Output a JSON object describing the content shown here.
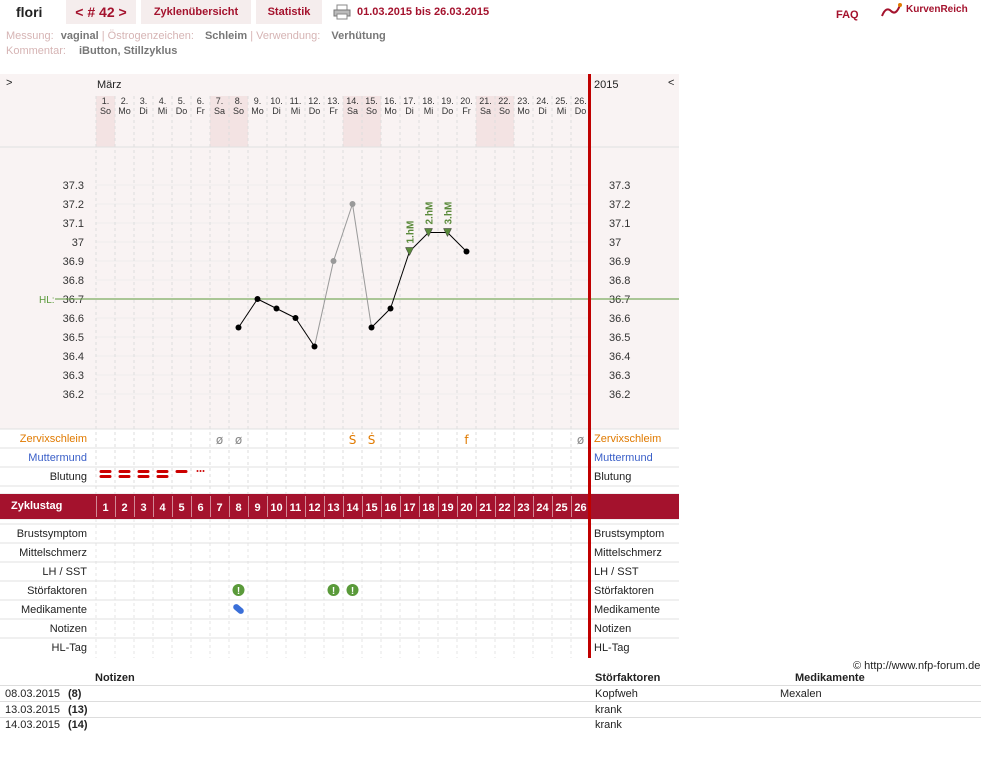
{
  "header": {
    "user": "flori",
    "cycle": "< # 42 >",
    "tab_overview": "Zyklenübersicht",
    "tab_stats": "Statistik",
    "date_range": "01.03.2015 bis 26.03.2015",
    "faq": "FAQ",
    "logo": "KurvenReich"
  },
  "meta": {
    "measure_label": "Messung:",
    "measure": "vaginal",
    "estrogen_label": "Östrogenzeichen:",
    "estrogen": "Schleim",
    "usage_label": "Verwendung:",
    "usage": "Verhütung",
    "comment_label": "Kommentar:",
    "comment": "iButton, Stillzyklus"
  },
  "chart_nav": {
    "left": ">",
    "right": "<",
    "month": "März",
    "year": "2015"
  },
  "chart_data": {
    "type": "line",
    "days": [
      "1.",
      "2.",
      "3.",
      "4.",
      "5.",
      "6.",
      "7.",
      "8.",
      "9.",
      "10.",
      "11.",
      "12.",
      "13.",
      "14.",
      "15.",
      "16.",
      "17.",
      "18.",
      "19.",
      "20.",
      "21.",
      "22.",
      "23.",
      "24.",
      "25.",
      "26."
    ],
    "weekdays": [
      "So",
      "Mo",
      "Di",
      "Mi",
      "Do",
      "Fr",
      "Sa",
      "So",
      "Mo",
      "Di",
      "Mi",
      "Do",
      "Fr",
      "Sa",
      "So",
      "Mo",
      "Di",
      "Mi",
      "Do",
      "Fr",
      "Sa",
      "So",
      "Mo",
      "Di",
      "Mi",
      "Do"
    ],
    "weekend_days": [
      1,
      7,
      8,
      14,
      15,
      21,
      22
    ],
    "y_ticks": [
      "37.3",
      "37.2",
      "37.1",
      "37",
      "36.9",
      "36.8",
      "36.7",
      "36.6",
      "36.5",
      "36.4",
      "36.3",
      "36.2"
    ],
    "ylim": [
      36.2,
      37.3
    ],
    "hl_label": "HL:",
    "hl": 36.7,
    "series": [
      {
        "day": 8,
        "temp": 36.55,
        "excluded": false
      },
      {
        "day": 9,
        "temp": 36.7,
        "excluded": false
      },
      {
        "day": 10,
        "temp": 36.65,
        "excluded": false
      },
      {
        "day": 11,
        "temp": 36.6,
        "excluded": false
      },
      {
        "day": 12,
        "temp": 36.45,
        "excluded": false
      },
      {
        "day": 13,
        "temp": 36.9,
        "excluded": true
      },
      {
        "day": 14,
        "temp": 37.2,
        "excluded": true
      },
      {
        "day": 15,
        "temp": 36.55,
        "excluded": false
      },
      {
        "day": 16,
        "temp": 36.65,
        "excluded": false
      },
      {
        "day": 17,
        "temp": 36.95,
        "excluded": false
      },
      {
        "day": 18,
        "temp": 37.05,
        "excluded": false
      },
      {
        "day": 19,
        "temp": 37.05,
        "excluded": false
      },
      {
        "day": 20,
        "temp": 36.95,
        "excluded": false
      }
    ],
    "hm_markers": [
      {
        "day": 17,
        "label": "1.hM"
      },
      {
        "day": 18,
        "label": "2.hM"
      },
      {
        "day": 19,
        "label": "3.hM"
      }
    ],
    "zervix_label": "Zervixschleim",
    "zervix": [
      {
        "day": 7,
        "sym": "ø"
      },
      {
        "day": 8,
        "sym": "ø"
      },
      {
        "day": 14,
        "sym": "Ṡ"
      },
      {
        "day": 15,
        "sym": "Ṡ"
      },
      {
        "day": 20,
        "sym": "f"
      },
      {
        "day": 26,
        "sym": "ø"
      }
    ],
    "muttermund_label": "Muttermund",
    "blutung_label": "Blutung",
    "blutung": [
      {
        "day": 1,
        "level": 3
      },
      {
        "day": 2,
        "level": 3
      },
      {
        "day": 3,
        "level": 2
      },
      {
        "day": 4,
        "level": 2
      },
      {
        "day": 5,
        "level": 1
      },
      {
        "day": 6,
        "level": 0
      }
    ],
    "zyklustag_label": "Zyklustag",
    "cycle_days": [
      "1",
      "2",
      "3",
      "4",
      "5",
      "6",
      "7",
      "8",
      "9",
      "10",
      "11",
      "12",
      "13",
      "14",
      "15",
      "16",
      "17",
      "18",
      "19",
      "20",
      "21",
      "22",
      "23",
      "24",
      "25",
      "26"
    ],
    "bottom_rows": [
      "Brustsymptom",
      "Mittelschmerz",
      "LH / SST",
      "Störfaktoren",
      "Medikamente",
      "Notizen",
      "HL-Tag"
    ],
    "stoer_days": [
      8,
      13,
      14
    ],
    "med_days": [
      8
    ]
  },
  "colors": {
    "brand": "#a4122d",
    "zervix": "#e07a00",
    "muttermund": "#3a5fc8",
    "weekend": "#f3e3e3",
    "hl_line": "#5a9a3a",
    "marker": "#5a8a3a"
  },
  "copyright": "© http://www.nfp-forum.de",
  "notes_table": {
    "headers": [
      "Notizen",
      "Störfaktoren",
      "Medikamente"
    ],
    "rows": [
      {
        "date": "08.03.2015",
        "day": "(8)",
        "stoer": "Kopfweh",
        "med": "Mexalen"
      },
      {
        "date": "13.03.2015",
        "day": "(13)",
        "stoer": "krank",
        "med": ""
      },
      {
        "date": "14.03.2015",
        "day": "(14)",
        "stoer": "krank",
        "med": ""
      }
    ]
  }
}
